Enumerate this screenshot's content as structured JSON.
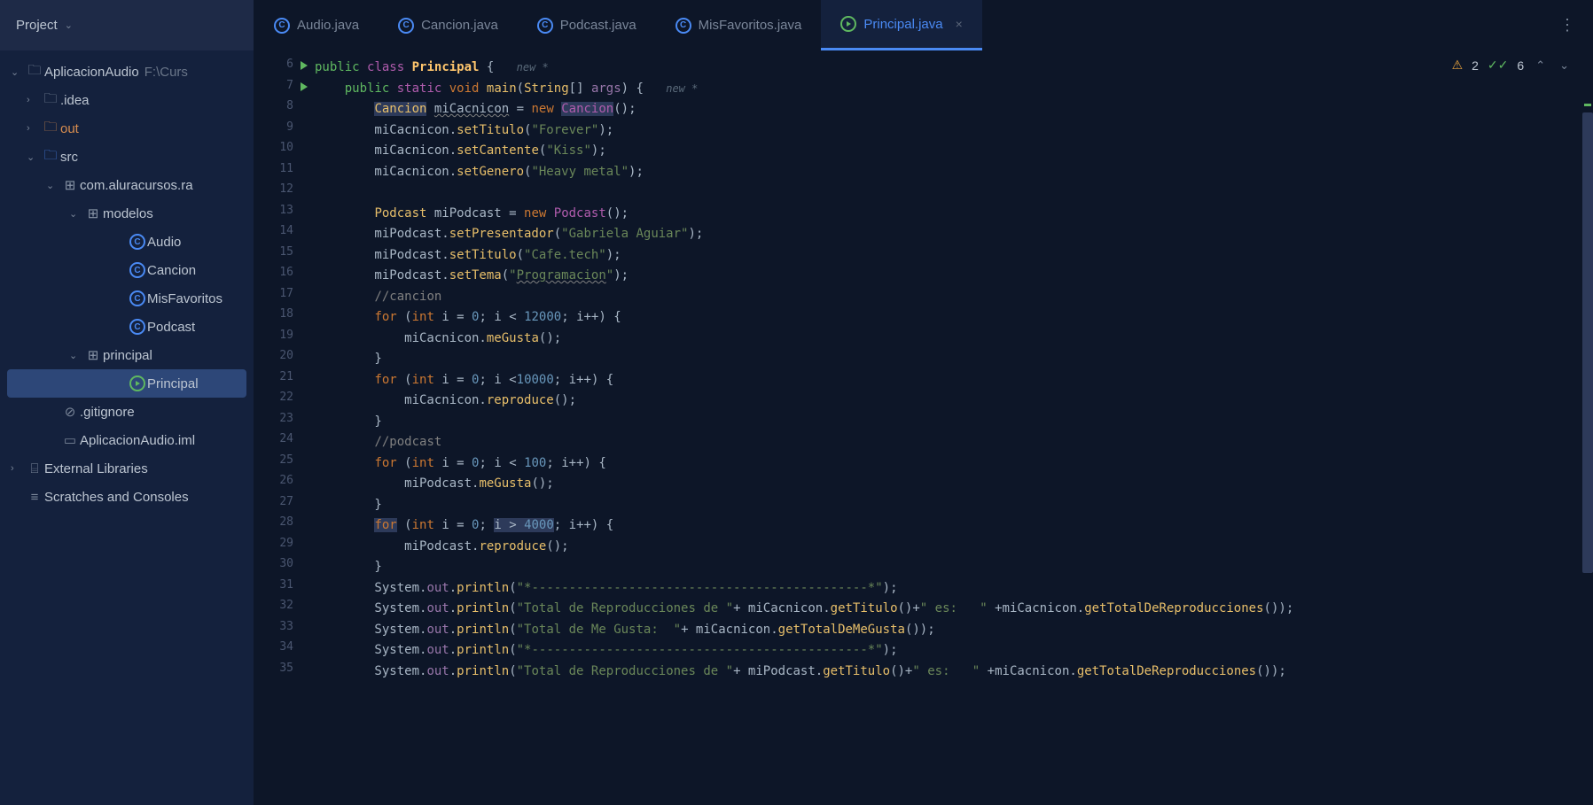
{
  "project_panel": {
    "title": "Project"
  },
  "tabs": [
    {
      "label": "Audio.java",
      "icon": "class",
      "active": false
    },
    {
      "label": "Cancion.java",
      "icon": "class",
      "active": false
    },
    {
      "label": "Podcast.java",
      "icon": "class",
      "active": false
    },
    {
      "label": "MisFavoritos.java",
      "icon": "class",
      "active": false
    },
    {
      "label": "Principal.java",
      "icon": "run",
      "active": true,
      "closable": true
    }
  ],
  "tree": {
    "root": {
      "name": "AplicacionAudio",
      "path": "F:\\Curs"
    },
    "items": [
      {
        "name": ".idea",
        "type": "folder",
        "indent": 1,
        "expanded": false
      },
      {
        "name": "out",
        "type": "folder",
        "indent": 1,
        "expanded": false,
        "color": "orange"
      },
      {
        "name": "src",
        "type": "folder",
        "indent": 1,
        "expanded": true,
        "color": "blue"
      },
      {
        "name": "com.aluracursos.ra",
        "type": "package",
        "indent": 2,
        "expanded": true
      },
      {
        "name": "modelos",
        "type": "package",
        "indent": 3,
        "expanded": true
      },
      {
        "name": "Audio",
        "type": "class",
        "indent": 5
      },
      {
        "name": "Cancion",
        "type": "class",
        "indent": 5
      },
      {
        "name": "MisFavoritos",
        "type": "class",
        "indent": 5
      },
      {
        "name": "Podcast",
        "type": "class",
        "indent": 5
      },
      {
        "name": "principal",
        "type": "package",
        "indent": 3,
        "expanded": true
      },
      {
        "name": "Principal",
        "type": "run-class",
        "indent": 5,
        "selected": true
      },
      {
        "name": ".gitignore",
        "type": "file-x",
        "indent": 2
      },
      {
        "name": "AplicacionAudio.iml",
        "type": "file",
        "indent": 2
      },
      {
        "name": "External Libraries",
        "type": "lib",
        "indent": 0,
        "arrow": ">"
      },
      {
        "name": "Scratches and Consoles",
        "type": "scratch",
        "indent": 0
      }
    ]
  },
  "status": {
    "warnings": "2",
    "oks": "6"
  },
  "gutter_start": 6,
  "gutter_end": 35,
  "gutter_run_lines": [
    6,
    7
  ],
  "code": {
    "l6": {
      "hint": "new *"
    },
    "l7": {
      "hint": "new *"
    },
    "l8": {
      "type": "Cancion",
      "var": "miCacnicon",
      "ctor": "Cancion"
    },
    "l9": {
      "obj": "miCacnicon",
      "fn": "setTitulo",
      "arg": "\"Forever\""
    },
    "l10": {
      "obj": "miCacnicon",
      "fn": "setCantente",
      "arg": "\"Kiss\""
    },
    "l11": {
      "obj": "miCacnicon",
      "fn": "setGenero",
      "arg": "\"Heavy metal\""
    },
    "l13": {
      "type": "Podcast",
      "var": "miPodcast",
      "ctor": "Podcast"
    },
    "l14": {
      "obj": "miPodcast",
      "fn": "setPresentador",
      "arg": "\"Gabriela Aguiar\""
    },
    "l15": {
      "obj": "miPodcast",
      "fn": "setTitulo",
      "arg": "\"Cafe.tech\""
    },
    "l16": {
      "obj": "miPodcast",
      "fn": "setTema",
      "arg": "\"Programacion\""
    },
    "l17": {
      "c": "//cancion"
    },
    "l18": {
      "limit": "12000"
    },
    "l19": {
      "obj": "miCacnicon",
      "fn": "meGusta"
    },
    "l21": {
      "op": "<",
      "limit": "10000"
    },
    "l22": {
      "obj": "miCacnicon",
      "fn": "reproduce"
    },
    "l24": {
      "c": "//podcast"
    },
    "l25": {
      "limit": "100"
    },
    "l26": {
      "obj": "miPodcast",
      "fn": "meGusta"
    },
    "l28": {
      "op": ">",
      "limit": "4000"
    },
    "l29": {
      "obj": "miPodcast",
      "fn": "reproduce"
    },
    "l31": {
      "s": "\"*---------------------------------------------*\""
    },
    "l32": {
      "s1": "\"Total de Reproducciones de \"",
      "obj1": "miCacnicon",
      "fn1": "getTitulo",
      "s2": "\" es:   \"",
      "obj2": "miCacnicon",
      "fn2": "getTotalDeReproducciones"
    },
    "l33": {
      "s1": "\"Total de Me Gusta:  \"",
      "obj": "miCacnicon",
      "fn": "getTotalDeMeGusta"
    },
    "l34": {
      "s": "\"*---------------------------------------------*\""
    },
    "l35": {
      "s1": "\"Total de Reproducciones de \"",
      "obj1": "miPodcast",
      "fn1": "getTitulo",
      "s2": "\" es:   \"",
      "obj2": "miCacnicon",
      "fn2": "getTotalDeReproducciones"
    }
  }
}
